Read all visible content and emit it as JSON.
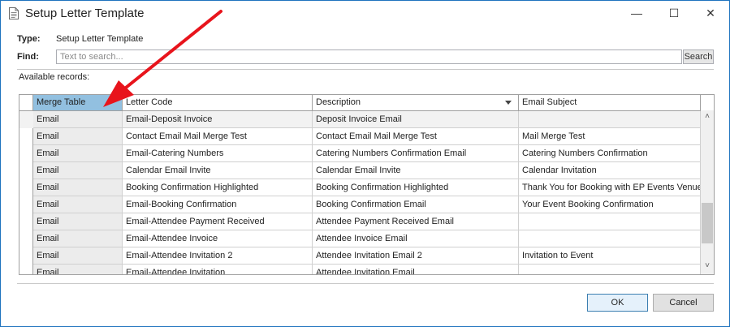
{
  "window": {
    "title": "Setup Letter Template",
    "min_glyph": "—",
    "max_glyph": "☐",
    "close_glyph": "✕",
    "border_color": "#1e73be"
  },
  "form": {
    "type_label": "Type:",
    "type_value": "Setup Letter Template",
    "find_label": "Find:",
    "search_placeholder": "Text to search...",
    "search_value": "",
    "search_button": "Search",
    "available_label": "Available records:"
  },
  "grid": {
    "columns": [
      "Merge Table",
      "Letter Code",
      "Description",
      "Email Subject"
    ],
    "selected_column": "Merge Table",
    "sorted_column": "Description",
    "header_selected_color": "#92c0e0",
    "rows": [
      [
        "Email",
        "Email-Deposit Invoice",
        "Deposit Invoice Email",
        ""
      ],
      [
        "Email",
        "Contact Email Mail Merge Test",
        "Contact Email Mail Merge Test",
        "Mail Merge Test"
      ],
      [
        "Email",
        "Email-Catering Numbers",
        "Catering Numbers Confirmation Email",
        "Catering Numbers Confirmation"
      ],
      [
        "Email",
        "Calendar Email Invite",
        "Calendar Email Invite",
        "Calendar Invitation"
      ],
      [
        "Email",
        "Booking Confirmation Highlighted",
        "Booking Confirmation Highlighted",
        "Thank You for Booking with EP Events Venue"
      ],
      [
        "Email",
        "Email-Booking Confirmation",
        "Booking Confirmation Email",
        "Your Event Booking Confirmation"
      ],
      [
        "Email",
        "Email-Attendee Payment Received",
        "Attendee Payment Received Email",
        ""
      ],
      [
        "Email",
        "Email-Attendee Invoice",
        "Attendee Invoice Email",
        ""
      ],
      [
        "Email",
        "Email-Attendee Invitation 2",
        "Attendee Invitation Email 2",
        "Invitation to Event"
      ],
      [
        "Email",
        "Email-Attendee Invitation",
        "Attendee Invitation Email",
        ""
      ]
    ],
    "row_bg_first": "#f2f2f2",
    "scroll_up_glyph": "˄",
    "scroll_down_glyph": "˅"
  },
  "buttons": {
    "ok": "OK",
    "cancel": "Cancel"
  },
  "annotation": {
    "arrow_color": "#e8141c"
  }
}
